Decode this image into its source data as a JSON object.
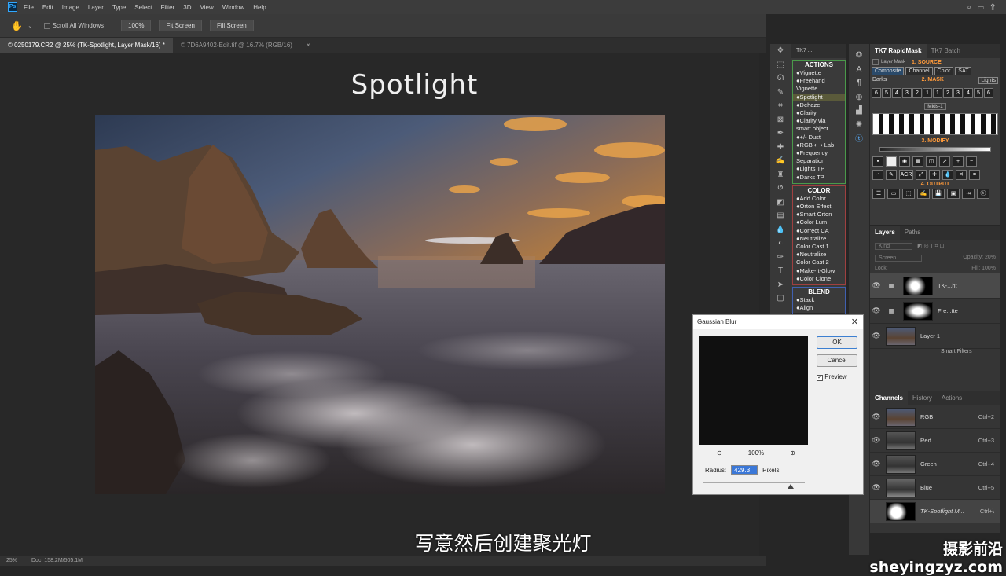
{
  "menubar": {
    "items": [
      "File",
      "Edit",
      "Image",
      "Layer",
      "Type",
      "Select",
      "Filter",
      "3D",
      "View",
      "Window",
      "Help"
    ]
  },
  "options": {
    "scroll_all_label": "Scroll All Windows",
    "zoom_value": "100%",
    "fit_screen": "Fit Screen",
    "fill_screen": "Fill Screen"
  },
  "tabs": [
    {
      "label": "© 0250179.CR2 @ 25% (TK-Spotlight, Layer Mask/16) *",
      "close": "×"
    },
    {
      "label": "© 7D6A9402-Edit.tif @ 16.7% (RGB/16)",
      "close": "×"
    }
  ],
  "canvas": {
    "title": "Spotlight",
    "subtitle": "写意然后创建聚光灯",
    "photo_colors": {
      "sky": "#3e4d63",
      "sunset": "#d99a48",
      "rock": "#4a3a2e",
      "water": "#8a8690"
    }
  },
  "status": {
    "zoom": "25%",
    "doc": "Doc: 158.2M/505.1M"
  },
  "tools": [
    "move-icon",
    "marquee-icon",
    "lasso-icon",
    "quick-select-icon",
    "crop-icon",
    "frame-icon",
    "eyedropper-icon",
    "healing-icon",
    "brush-icon",
    "stamp-icon",
    "history-brush-icon",
    "eraser-icon",
    "gradient-icon",
    "blur-icon",
    "dodge-icon",
    "pen-icon",
    "type-icon",
    "path-select-icon",
    "rectangle-icon"
  ],
  "tk7": {
    "header": "TK7 ...",
    "actions_title": "ACTIONS",
    "actions": [
      "●Vignette",
      "●Freehand",
      "  Vignette",
      "●Spotlight",
      "●Dehaze",
      "●Clarity",
      "●Clarity via",
      "  smart object",
      "●+/- Dust",
      "●RGB ⟷ Lab",
      "●Frequency",
      "  Separation",
      "●Lights TP",
      "●Darks TP"
    ],
    "color_title": "COLOR",
    "color": [
      "●Add Color",
      "●Orton Effect",
      "●Smart Orton",
      "●Color Lum",
      "●Correct CA",
      "●Neutralize",
      "  Color Cast 1",
      "●Neutralize",
      "  Color Cast 2",
      "●Make-It-Glow",
      "●Color Clone"
    ],
    "blend_title": "BLEND",
    "blend": [
      "●Stack",
      "●Align"
    ]
  },
  "rapidmask": {
    "tab_active": "TK7 RapidMask",
    "tab_other": "TK7 Batch",
    "layer_mask": "Layer Mask",
    "source_title": "1. SOURCE",
    "source_buttons": [
      "Composite",
      "Channel",
      "Color",
      "SAT"
    ],
    "mask_title": "2. MASK",
    "darks": "Darks",
    "lights": "Lights",
    "numbers_row1": [
      "6",
      "5",
      "4",
      "3",
      "2",
      "1",
      "1",
      "2",
      "3",
      "4",
      "5",
      "6"
    ],
    "mids": "Mids-1",
    "modify_title": "3. MODIFY",
    "output_title": "4. OUTPUT",
    "acr": "ACR"
  },
  "layers_panel": {
    "tabs": [
      "Layers",
      "Paths"
    ],
    "kind": "Kind",
    "blend_mode": "Screen",
    "opacity_label": "Opacity:",
    "opacity_value": "20%",
    "lock_label": "Lock:",
    "fill_label": "Fill:",
    "fill_value": "100%",
    "layers": [
      {
        "name": "TK-...ht"
      },
      {
        "name": "Fre...tte"
      },
      {
        "name": "Layer 1"
      },
      {
        "name": "Smart Filters"
      }
    ]
  },
  "channels_panel": {
    "tabs": [
      "Channels",
      "History",
      "Actions"
    ],
    "channels": [
      {
        "name": "RGB",
        "shortcut": "Ctrl+2"
      },
      {
        "name": "Red",
        "shortcut": "Ctrl+3"
      },
      {
        "name": "Green",
        "shortcut": "Ctrl+4"
      },
      {
        "name": "Blue",
        "shortcut": "Ctrl+5"
      },
      {
        "name": "TK-Spotlight M...",
        "shortcut": "Ctrl+\\"
      }
    ]
  },
  "gaussian_blur": {
    "title": "Gaussian Blur",
    "ok": "OK",
    "cancel": "Cancel",
    "preview": "Preview",
    "zoom": "100%",
    "radius_label": "Radius:",
    "radius_value": "429.3",
    "radius_unit": "Pixels",
    "slider_fraction": 0.86
  },
  "watermark": "摄影前沿 sheyingzyz.com"
}
